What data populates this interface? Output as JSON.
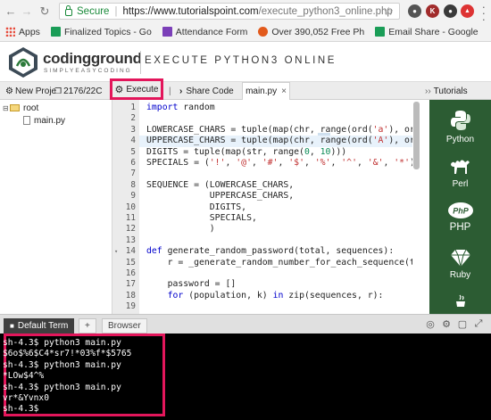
{
  "browser": {
    "secure_label": "Secure",
    "url_host": "https://www.tutorialspoint.com",
    "url_path": "/execute_python3_online.php",
    "bookmarks": [
      {
        "label": "Apps",
        "color": "#4a7fd4"
      },
      {
        "label": "Finalized Topics - Go",
        "color": "#1a9d57"
      },
      {
        "label": "Attendance Form",
        "color": "#7b3fb8"
      },
      {
        "label": "Over 390,052 Free Ph",
        "color": "#e25a1c"
      },
      {
        "label": "Email Share - Google",
        "color": "#1a9d57"
      }
    ]
  },
  "header": {
    "logo_text": "codingground",
    "logo_sub": "SIMPLYEASYCODING",
    "title": "EXECUTE PYTHON3 ONLINE"
  },
  "toolbar": {
    "new_project": "New Proje",
    "project_id": "2176/22C",
    "execute": "Execute",
    "share_code": "Share Code",
    "tab_file": "main.py",
    "tutorials": "Tutorials"
  },
  "filetree": {
    "root": "root",
    "file": "main.py"
  },
  "editor": {
    "lines": [
      {
        "n": "1",
        "t": "import random"
      },
      {
        "n": "2",
        "t": ""
      },
      {
        "n": "3",
        "t": "LOWERCASE_CHARS = tuple(map(chr, range(ord('a'), ord("
      },
      {
        "n": "4",
        "t": "UPPERCASE_CHARS = tuple(map(chr, range(ord('A'), ord("
      },
      {
        "n": "5",
        "t": "DIGITS = tuple(map(str, range(0, 10)))"
      },
      {
        "n": "6",
        "t": "SPECIALS = ('!', '@', '#', '$', '%', '^', '&', '*')"
      },
      {
        "n": "7",
        "t": ""
      },
      {
        "n": "8",
        "t": "SEQUENCE = (LOWERCASE_CHARS,"
      },
      {
        "n": "9",
        "t": "            UPPERCASE_CHARS,"
      },
      {
        "n": "10",
        "t": "            DIGITS,"
      },
      {
        "n": "11",
        "t": "            SPECIALS,"
      },
      {
        "n": "12",
        "t": "            )"
      },
      {
        "n": "13",
        "t": ""
      },
      {
        "n": "14",
        "t": "def generate_random_password(total, sequences):"
      },
      {
        "n": "15",
        "t": "    r = _generate_random_number_for_each_sequence(tot"
      },
      {
        "n": "16",
        "t": ""
      },
      {
        "n": "17",
        "t": "    password = []"
      },
      {
        "n": "18",
        "t": "    for (population, k) in zip(sequences, r):"
      },
      {
        "n": "19",
        "t": ""
      }
    ]
  },
  "sidebar_right": {
    "languages": [
      "Python",
      "Perl",
      "PHP",
      "Ruby"
    ]
  },
  "terminal": {
    "default_tab": "Default Term",
    "add_tab": "+",
    "browser_tab": "Browser",
    "lines": [
      "sh-4.3$ python3 main.py",
      "$6o$%6$C4*sr7!*03%f*$5765",
      "sh-4.3$ python3 main.py",
      "*LOw$4^%",
      "sh-4.3$ python3 main.py",
      "vr*&Yvnx0",
      "sh-4.3$"
    ]
  },
  "colors": {
    "highlight_box": "#e3165b",
    "sidebar_green": "#2c5c33",
    "terminal_bg": "#000000"
  }
}
